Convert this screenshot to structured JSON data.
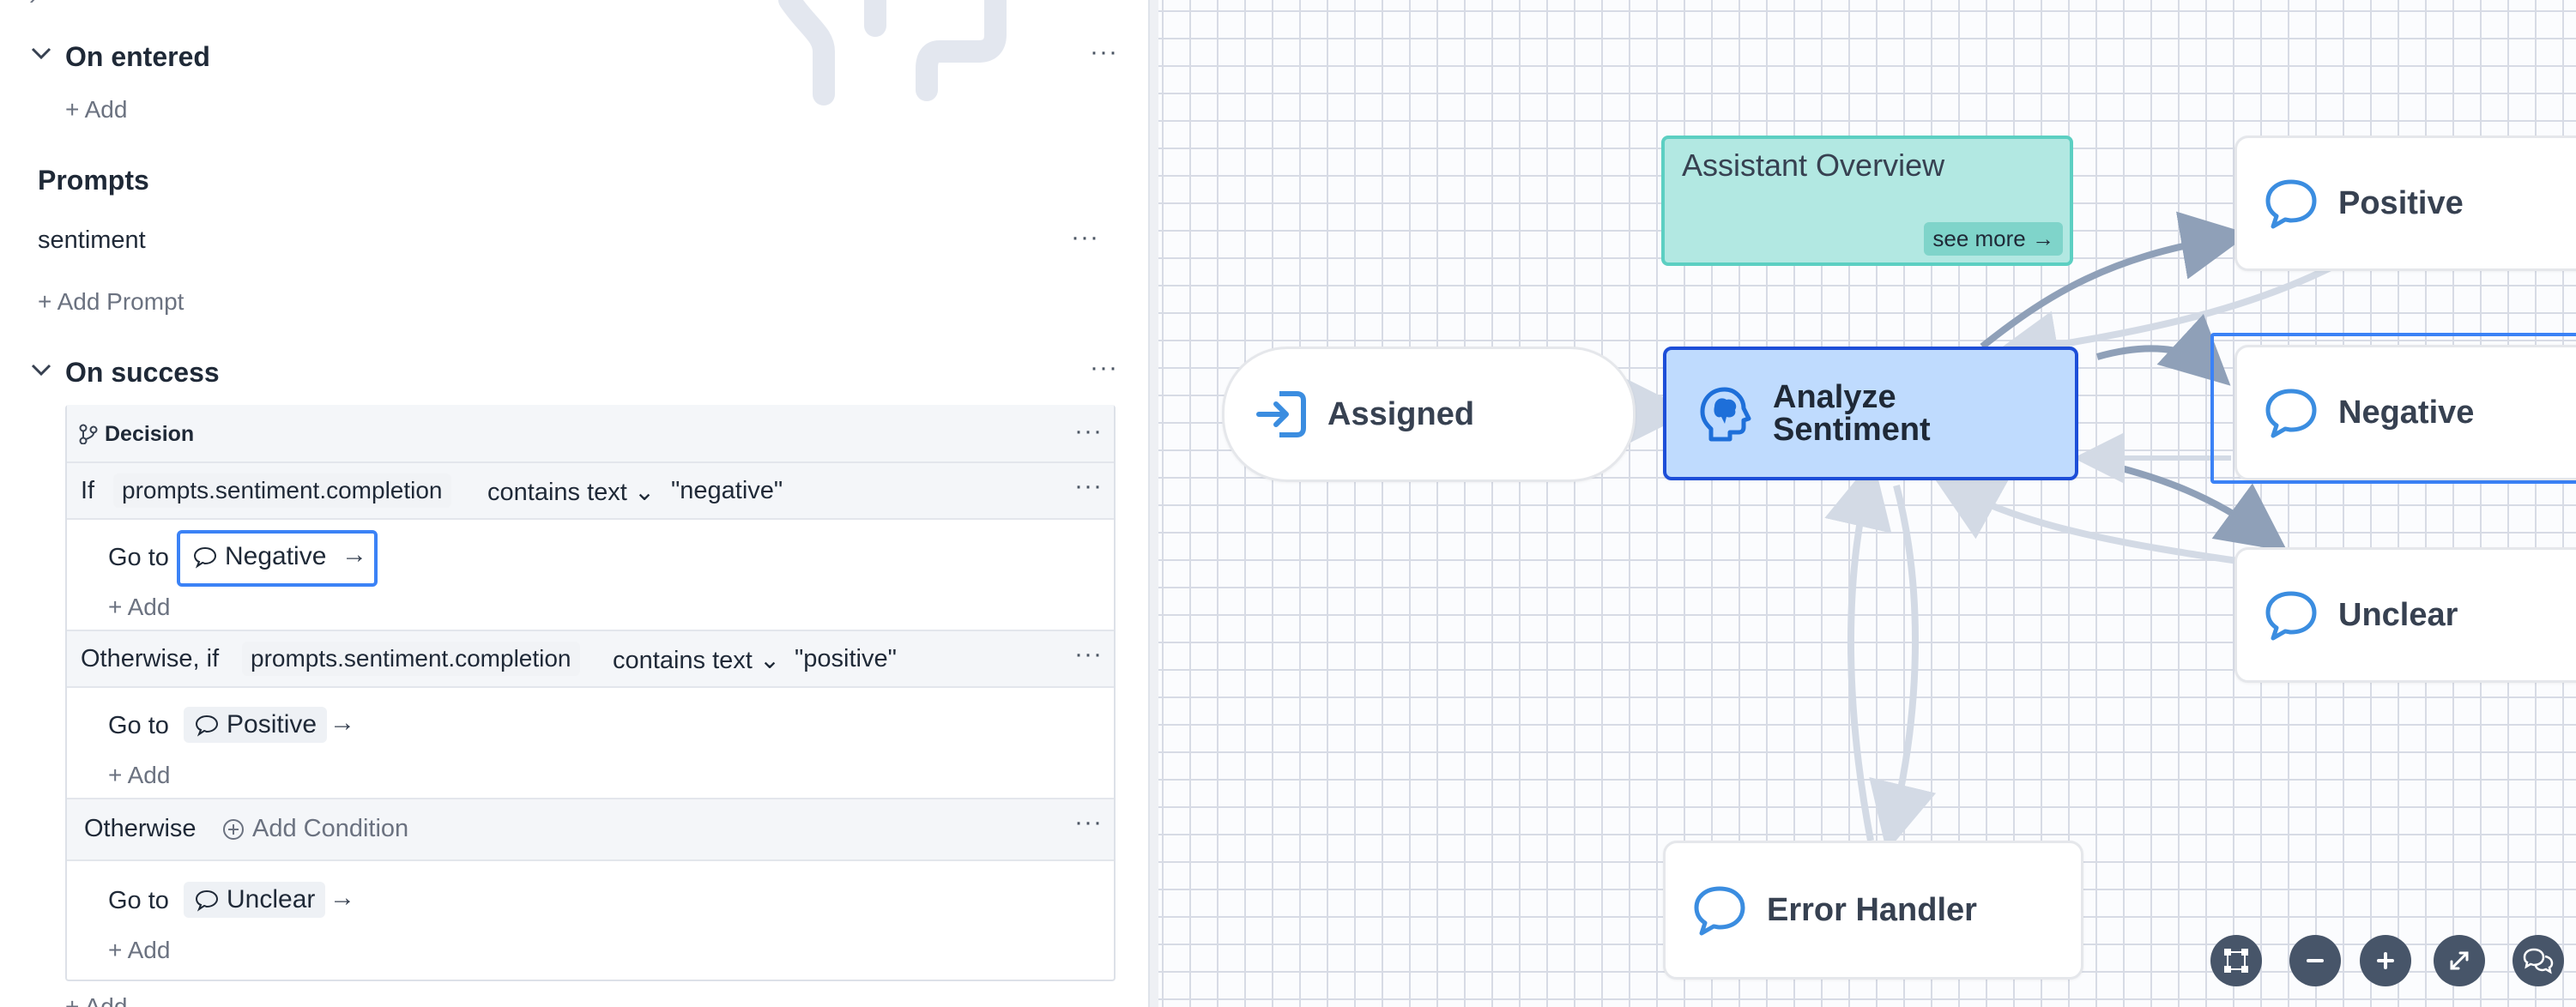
{
  "sidebar": {
    "on_entered": {
      "title": "On entered",
      "add_label": "+ Add"
    },
    "prompts": {
      "title": "Prompts",
      "item": "sentiment",
      "add_label": "+ Add Prompt"
    },
    "on_success": {
      "title": "On success"
    },
    "decision": {
      "title": "Decision",
      "conditions": [
        {
          "prefix": "If",
          "variable": "prompts.sentiment.completion",
          "operator": "contains text",
          "value": "\"negative\"",
          "goto_label": "Go to",
          "target": "Negative",
          "add_label": "+ Add"
        },
        {
          "prefix": "Otherwise, if",
          "variable": "prompts.sentiment.completion",
          "operator": "contains text",
          "value": "\"positive\"",
          "goto_label": "Go to",
          "target": "Positive",
          "add_label": "+ Add"
        }
      ],
      "otherwise": {
        "prefix": "Otherwise",
        "add_condition_label": "Add Condition",
        "goto_label": "Go to",
        "target": "Unclear",
        "add_label": "+ Add"
      }
    },
    "bottom_add_label": "+ Add"
  },
  "canvas": {
    "overview": {
      "title": "Assistant Overview",
      "see_more_label": "see more"
    },
    "nodes": {
      "assigned": "Assigned",
      "analyze_line1": "Analyze",
      "analyze_line2": "Sentiment",
      "positive": "Positive",
      "negative": "Negative",
      "unclear": "Unclear",
      "error_handler": "Error Handler"
    }
  },
  "colors": {
    "accent_blue": "#3b82f6",
    "selected_node_fill": "#bfdbfe",
    "selected_node_border": "#1d4ed8",
    "overview_fill": "#b2e8e2",
    "overview_border": "#5ccfc2",
    "edge": "#94a3b8",
    "control_button": "#475569"
  }
}
